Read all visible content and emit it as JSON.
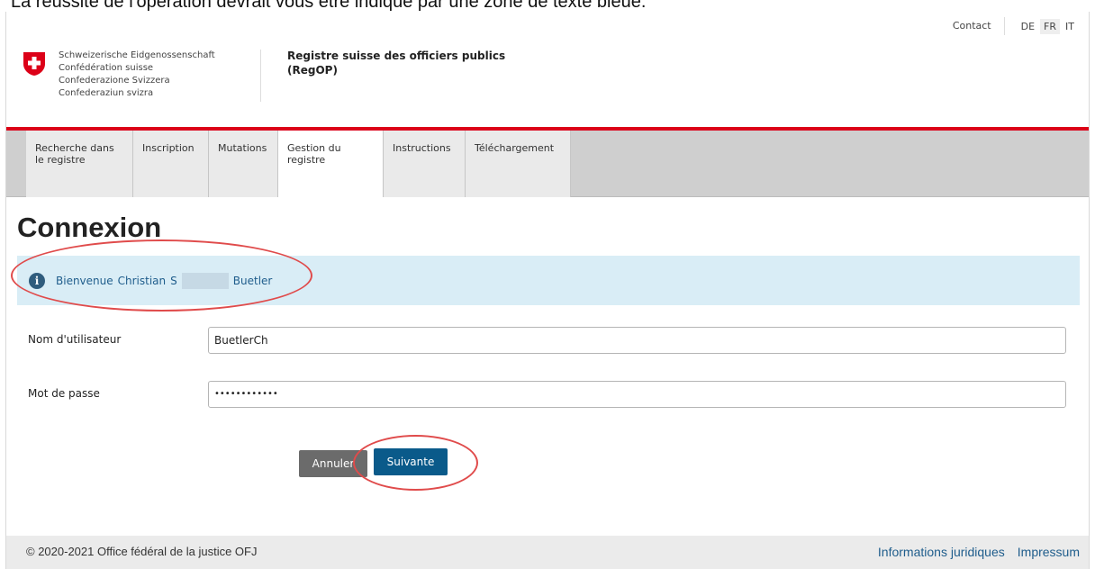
{
  "caption_text": "La réussite de l'opération devrait vous être indiqué par une zone de texte bleue.",
  "header": {
    "confederation": [
      "Schweizerische Eidgenossenschaft",
      "Confédération suisse",
      "Confederazione Svizzera",
      "Confederaziun svizra"
    ],
    "site_title_line1": "Registre suisse des officiers publics",
    "site_title_line2": "(RegOP)",
    "contact_label": "Contact",
    "languages": [
      "DE",
      "FR",
      "IT"
    ],
    "active_language": "FR"
  },
  "nav": {
    "tabs": [
      {
        "line1": "Recherche dans",
        "line2": "le registre"
      },
      {
        "line1": "Inscription",
        "line2": ""
      },
      {
        "line1": "Mutations",
        "line2": ""
      },
      {
        "line1": "Gestion du",
        "line2": "registre"
      },
      {
        "line1": "Instructions",
        "line2": ""
      },
      {
        "line1": "Téléchargement",
        "line2": ""
      }
    ],
    "active_tab": "Gestion du registre"
  },
  "main": {
    "title": "Connexion",
    "info": {
      "prefix": "Bienvenue",
      "first_name": "Christian",
      "initial": "S",
      "last_name": "Buetler"
    },
    "username_label": "Nom d'utilisateur",
    "username_value": "BuetlerCh",
    "password_label": "Mot de passe",
    "password_value": "••••••••••••",
    "cancel_label": "Annuler",
    "next_label": "Suivante"
  },
  "annotations": {
    "color": "#e04b4b"
  },
  "footer": {
    "copyright": "© 2020-2021 Office fédéral de la justice OFJ",
    "links": [
      "Informations juridiques",
      "Impressum"
    ]
  },
  "colors": {
    "swiss_red": "#dc0018",
    "primary_blue": "#0a5a8a",
    "info_bg": "#d9edf6",
    "info_text": "#1f5d8c"
  }
}
